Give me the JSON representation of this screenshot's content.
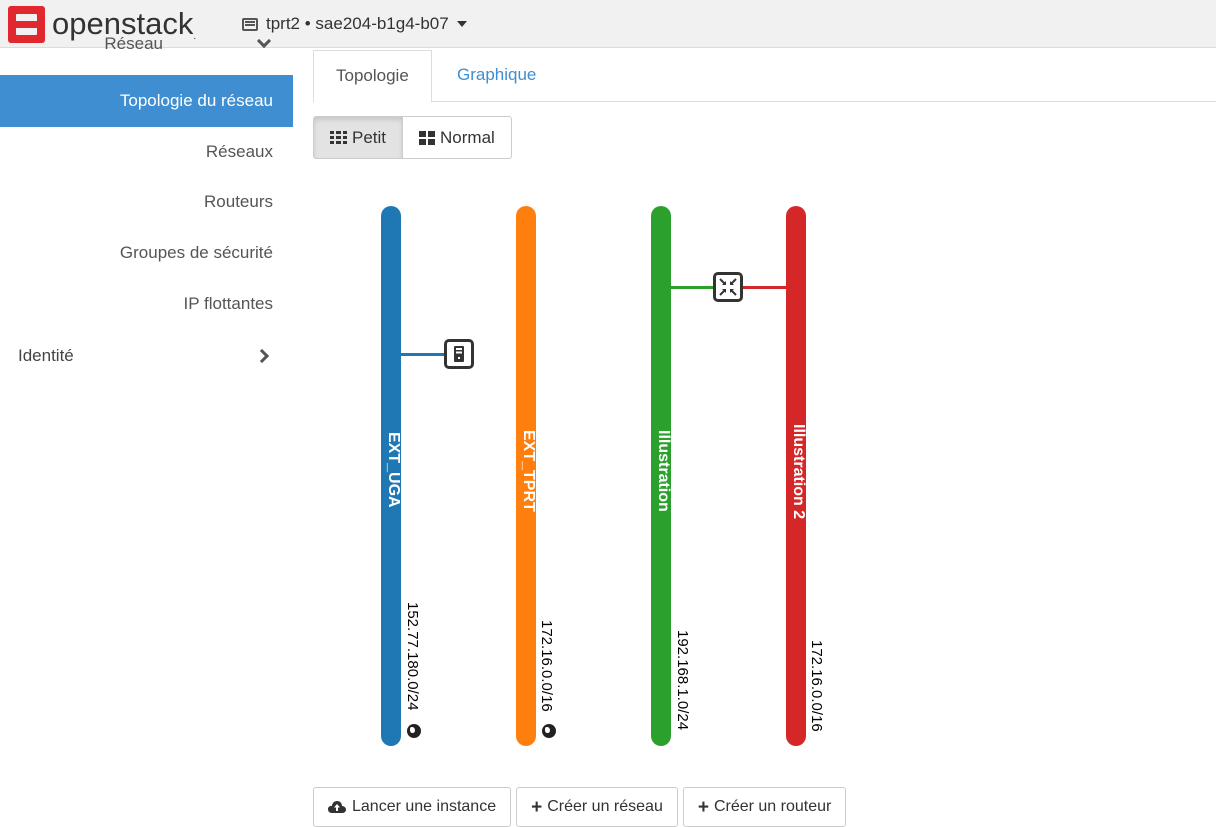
{
  "brand": {
    "name": "openstack",
    "trademark": "."
  },
  "project": {
    "label": "tprt2 • sae204-b1g4-b07"
  },
  "sidebar": {
    "section_label": "Réseau",
    "items": [
      {
        "label": "Topologie du réseau",
        "active": true
      },
      {
        "label": "Réseaux",
        "active": false
      },
      {
        "label": "Routeurs",
        "active": false
      },
      {
        "label": "Groupes de sécurité",
        "active": false
      },
      {
        "label": "IP flottantes",
        "active": false
      }
    ],
    "group": {
      "label": "Identité"
    }
  },
  "tabs": [
    {
      "label": "Topologie",
      "active": true
    },
    {
      "label": "Graphique",
      "active": false
    }
  ],
  "view_toggle": [
    {
      "label": "Petit",
      "pressed": true,
      "icon": "grid-small-icon"
    },
    {
      "label": "Normal",
      "pressed": false,
      "icon": "grid-normal-icon"
    }
  ],
  "networks": [
    {
      "name": "EXT_UGA",
      "cidr": "152.77.180.0/24",
      "color": "#1f77b4",
      "external": true
    },
    {
      "name": "EXT_TPRT",
      "cidr": "172.16.0.0/16",
      "color": "#ff7f0e",
      "external": true
    },
    {
      "name": "Illustration",
      "cidr": "192.168.1.0/24",
      "color": "#2ca02c",
      "external": false
    },
    {
      "name": "Illustration 2",
      "cidr": "172.16.0.0/16",
      "color": "#d62728",
      "external": false
    }
  ],
  "devices": [
    {
      "type": "instance",
      "icon": "instance-icon",
      "attached_to": [
        "EXT_UGA"
      ]
    },
    {
      "type": "router",
      "icon": "router-icon",
      "attached_to": [
        "Illustration",
        "Illustration 2"
      ]
    }
  ],
  "actions": [
    {
      "label": "Lancer une instance",
      "icon": "cloud-upload-icon"
    },
    {
      "label": "Créer un réseau",
      "icon": "plus-icon"
    },
    {
      "label": "Créer un routeur",
      "icon": "plus-icon"
    }
  ]
}
